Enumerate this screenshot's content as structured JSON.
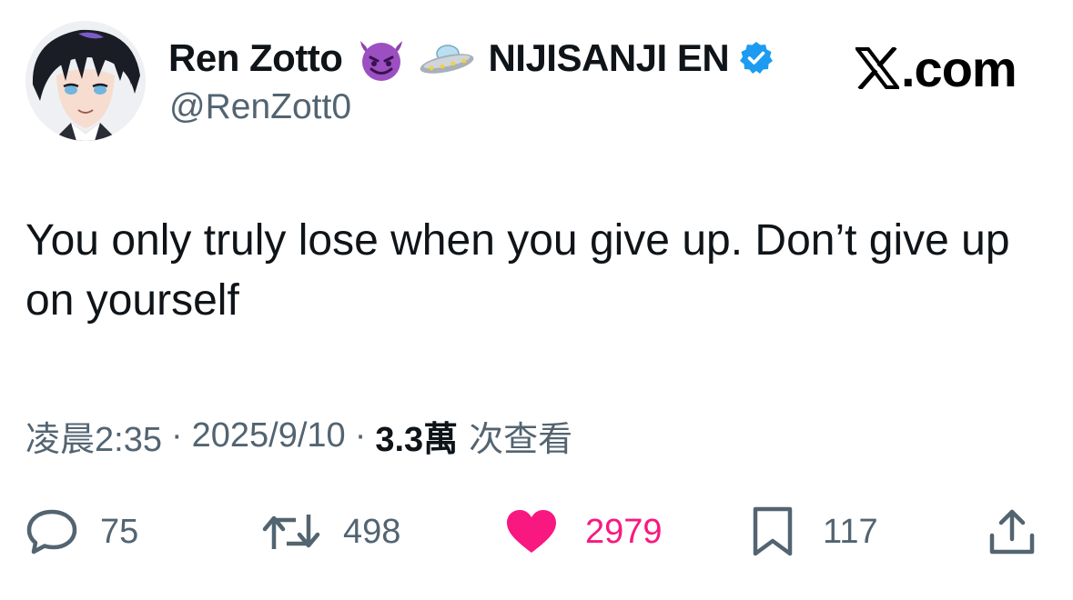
{
  "author": {
    "display_name": "Ren Zotto",
    "name_suffix": "NIJISANJI EN",
    "handle": "@RenZott0",
    "name_emojis": [
      "smiling-devil-emoji",
      "ufo-emoji"
    ],
    "verified": true
  },
  "site": {
    "label": ".com",
    "logo": "x-logo"
  },
  "tweet": {
    "text": "You only truly lose when you give up. Don’t give up on yourself"
  },
  "meta": {
    "time": "凌晨2:35",
    "separator": "·",
    "date": "2025/9/10",
    "views_count": "3.3萬",
    "views_label": "次查看"
  },
  "actions": {
    "replies": "75",
    "reposts": "498",
    "likes": "2979",
    "bookmarks": "117"
  },
  "colors": {
    "text": "#0f1419",
    "secondary": "#536471",
    "like": "#f91880",
    "verified": "#1d9bf0",
    "devil_emoji": "#8e44ad"
  }
}
